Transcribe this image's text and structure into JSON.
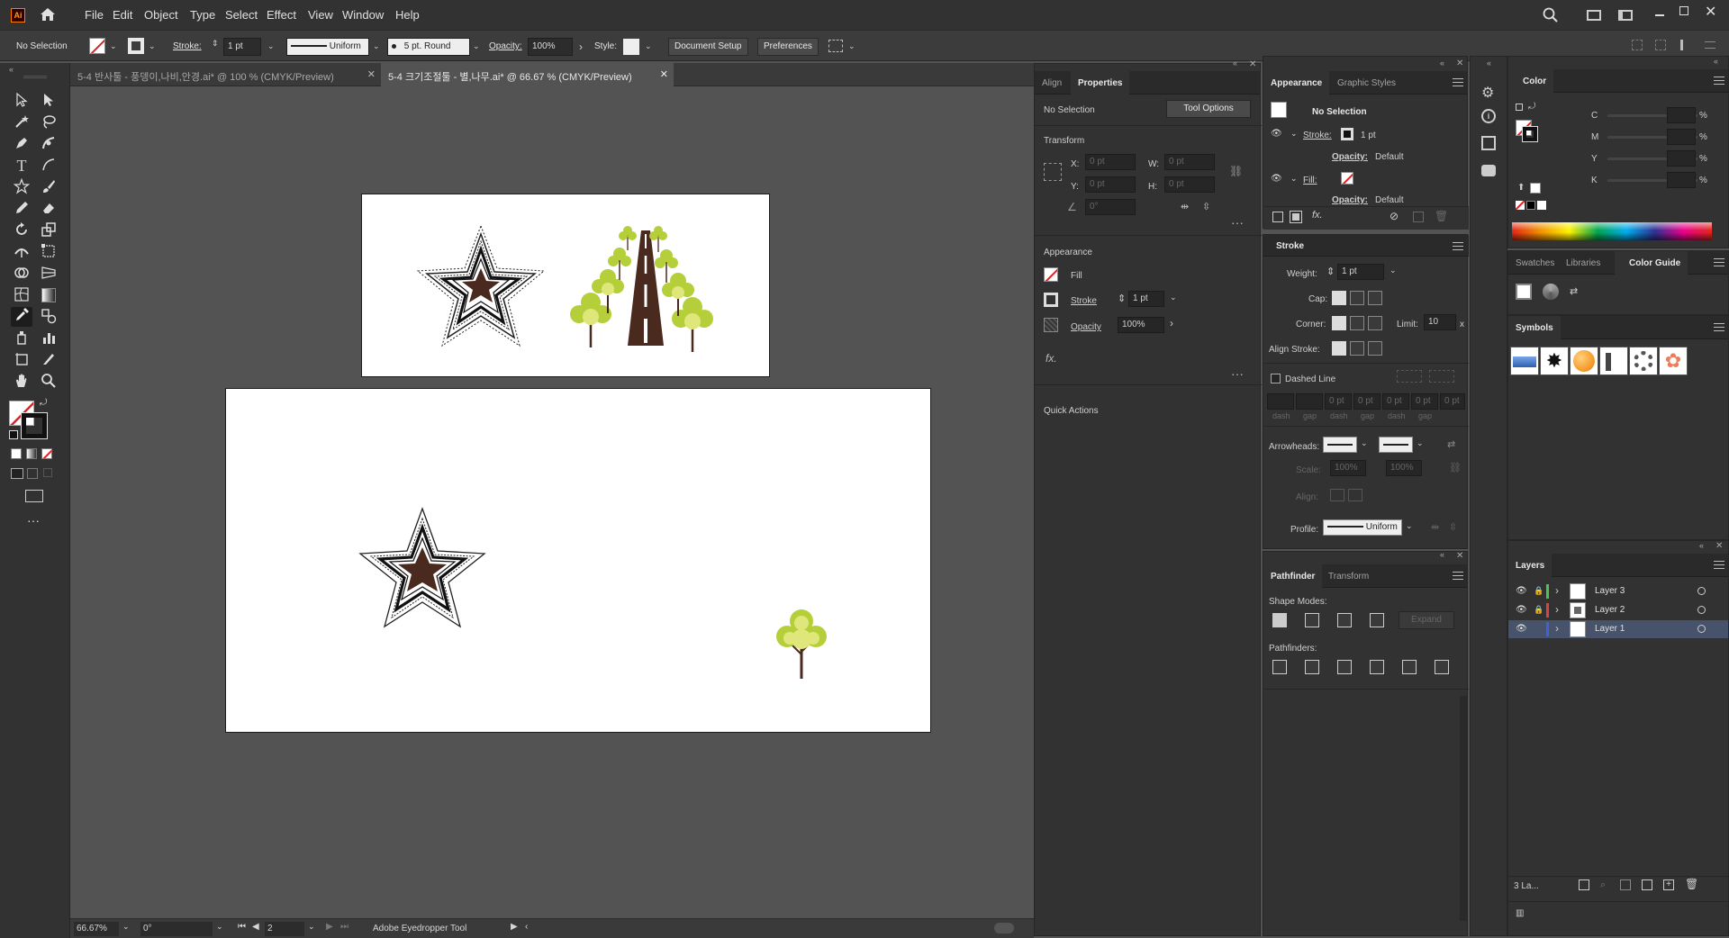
{
  "app": {
    "logo": "Ai"
  },
  "menu": [
    "File",
    "Edit",
    "Object",
    "Type",
    "Select",
    "Effect",
    "View",
    "Window",
    "Help"
  ],
  "control": {
    "selection": "No Selection",
    "stroke_label": "Stroke:",
    "stroke_value": "1 pt",
    "line_style": "Uniform",
    "brush": "5 pt. Round",
    "opacity_label": "Opacity:",
    "opacity_value": "100%",
    "style_label": "Style:",
    "doc_setup": "Document Setup",
    "preferences": "Preferences"
  },
  "tabs": [
    {
      "label": "5-4 반사툴 - 풍뎅이,나비,안경.ai* @ 100 % (CMYK/Preview)"
    },
    {
      "label": "5-4 크기조절툴 - 별,나무.ai* @ 66.67 % (CMYK/Preview)"
    }
  ],
  "status": {
    "zoom": "66.67%",
    "rotate": "0°",
    "artboard": "2",
    "tool": "Adobe Eyedropper Tool"
  },
  "properties": {
    "tabs": [
      "Align",
      "Properties"
    ],
    "no_selection": "No Selection",
    "tool_options": "Tool Options",
    "transform": "Transform",
    "x_label": "X:",
    "x_value": "0 pt",
    "y_label": "Y:",
    "y_value": "0 pt",
    "w_label": "W:",
    "w_value": "0 pt",
    "h_label": "H:",
    "h_value": "0 pt",
    "angle_value": "0°",
    "appearance": "Appearance",
    "fill": "Fill",
    "stroke": "Stroke",
    "stroke_value": "1 pt",
    "opacity": "Opacity",
    "opacity_value": "100%",
    "fx": "fx.",
    "quick_actions": "Quick Actions"
  },
  "appearance_panel": {
    "tabs": [
      "Appearance",
      "Graphic Styles"
    ],
    "no_selection": "No Selection",
    "stroke_label": "Stroke:",
    "stroke_value": "1 pt",
    "opacity_label": "Opacity:",
    "opacity_value": "Default",
    "fill_label": "Fill:",
    "opacity2_label": "Opacity:",
    "opacity2_value": "Default"
  },
  "stroke_panel": {
    "title": "Stroke",
    "weight_label": "Weight:",
    "weight_value": "1 pt",
    "cap_label": "Cap:",
    "corner_label": "Corner:",
    "limit_label": "Limit:",
    "limit_value": "10",
    "limit_unit": "x",
    "align_label": "Align Stroke:",
    "dashed": "Dashed Line",
    "dash_values": [
      "0 pt",
      "0 pt",
      "0 pt",
      "0 pt",
      "0 pt"
    ],
    "dash_labels": [
      "dash",
      "gap",
      "dash",
      "gap",
      "dash",
      "gap"
    ],
    "arrowheads": "Arrowheads:",
    "scale_label": "Scale:",
    "scale_values": [
      "100%",
      "100%"
    ],
    "align2_label": "Align:",
    "profile_label": "Profile:",
    "profile_value": "Uniform"
  },
  "pathfinder": {
    "tabs": [
      "Pathfinder",
      "Transform"
    ],
    "shape_modes": "Shape Modes:",
    "expand": "Expand",
    "pathfinders": "Pathfinders:"
  },
  "color": {
    "title": "Color",
    "channels": [
      "C",
      "M",
      "Y",
      "K"
    ],
    "unit": "%"
  },
  "swatch_tabs": [
    "Swatches",
    "Libraries",
    "Color Guide"
  ],
  "symbols": {
    "title": "Symbols"
  },
  "layers": {
    "title": "Layers",
    "items": [
      {
        "name": "Layer 3",
        "color": "#4fc24f"
      },
      {
        "name": "Layer 2",
        "color": "#e04040"
      },
      {
        "name": "Layer 1",
        "color": "#4060e0"
      }
    ],
    "count": "3 La..."
  },
  "colors": {
    "star": "#4a2a1e",
    "trunk": "#4a2a1e",
    "leaf": "#b5cf3a",
    "leaf_light": "#dfe77a"
  }
}
